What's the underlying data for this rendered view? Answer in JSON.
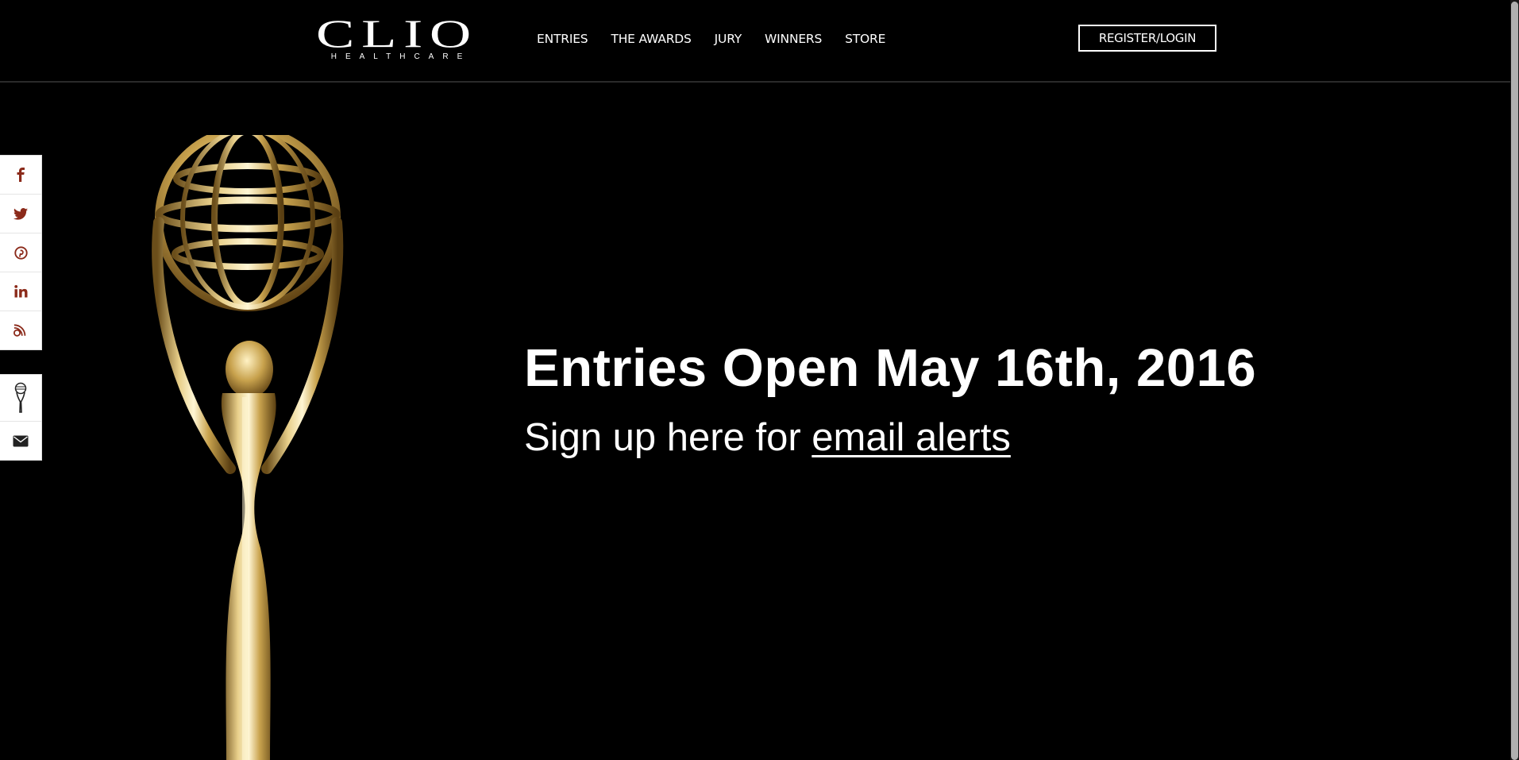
{
  "header": {
    "logo_main": "CLIO",
    "logo_sub": "HEALTHCARE",
    "nav": [
      {
        "label": "ENTRIES"
      },
      {
        "label": "THE AWARDS"
      },
      {
        "label": "JURY"
      },
      {
        "label": "WINNERS"
      },
      {
        "label": "STORE"
      }
    ],
    "register_label": "REGISTER/LOGIN"
  },
  "hero": {
    "title": "Entries Open May 16th, 2016",
    "sub_prefix": "Sign up here for ",
    "sub_link": "email alerts"
  },
  "social": {
    "icons": [
      "facebook-icon",
      "twitter-icon",
      "pinterest-icon",
      "linkedin-icon",
      "blogger-icon"
    ],
    "extra_icons": [
      "clio-statue-icon",
      "mail-icon"
    ],
    "icon_color": "#8b2a1a"
  },
  "colors": {
    "background": "#000000",
    "text": "#ffffff",
    "trophy_gold": "#d4b160"
  }
}
